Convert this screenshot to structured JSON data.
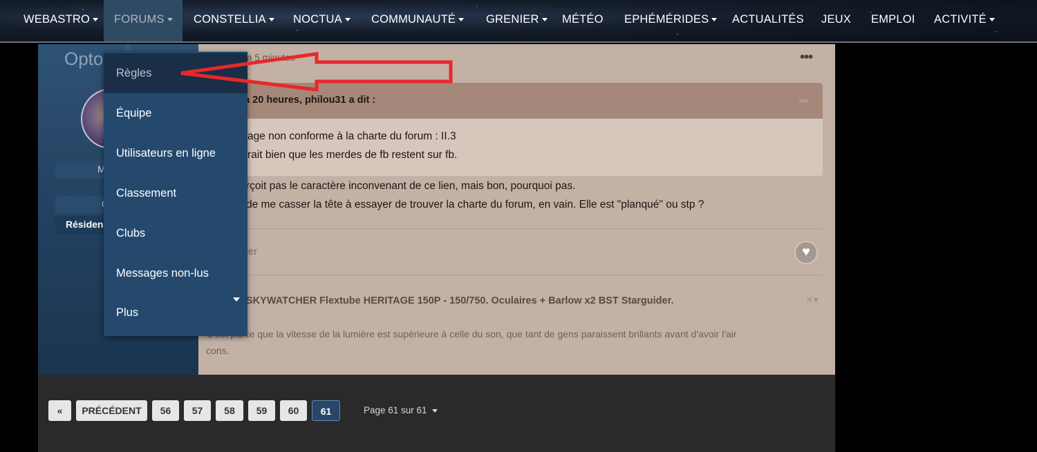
{
  "nav": {
    "items": [
      {
        "label": "WEBASTRO",
        "caret": true
      },
      {
        "label": "FORUMS",
        "caret": true,
        "active": true
      },
      {
        "label": "CONSTELLIA",
        "caret": true
      },
      {
        "label": "NOCTUA",
        "caret": true
      },
      {
        "label": "COMMUNAUTÉ",
        "caret": true
      },
      {
        "label": "GRENIER",
        "caret": true
      },
      {
        "label": "MÉTÉO",
        "caret": false
      },
      {
        "label": "EPHÉMÉRIDES",
        "caret": true
      },
      {
        "label": "ACTUALITÉS",
        "caret": false
      },
      {
        "label": "JEUX",
        "caret": false
      },
      {
        "label": "EMPLOI",
        "caret": false
      },
      {
        "label": "ACTIVITÉ",
        "caret": true
      }
    ]
  },
  "dropdown": {
    "items": [
      "Règles",
      "Équipe",
      "Utilisateurs en ligne",
      "Classement",
      "Clubs",
      "Messages non-lus",
      "Plus"
    ]
  },
  "sidebar": {
    "name": "Opto",
    "m_label": "M",
    "c_label": "C",
    "resident": "Résiden"
  },
  "post": {
    "time": "a 5 minutes",
    "quote": {
      "cite": "y a 20 heures, philou31 a dit :",
      "line1": "age non conforme à la charte du forum : II.3",
      "line2": "rait bien que les merdes de fb restent sur fb."
    },
    "body": {
      "line1": "rçoit pas le caractère inconvenant de ce lien, mais bon, pourquoi pas.",
      "line2": "de me casser la tête à essayer de trouver la charte du forum, en vain. Elle est \"planqué\" ou stp ?"
    },
    "react_text": "ter",
    "signature": "SKYWATCHER Flextube HERITAGE 150P - 150/750. Oculaires + Barlow x2  BST Starguider.",
    "sig_quote_line1": "C'est parce que la vitesse de la lumière est supérieure à celle du son, que tant de gens paraissent brillants avant d'avoir l'air",
    "sig_quote_line2": "cons."
  },
  "pagination": {
    "first": "«",
    "prev": "PRÉCÉDENT",
    "pages": [
      "56",
      "57",
      "58",
      "59",
      "60",
      "61"
    ],
    "current": "61",
    "info": "Page 61 sur 61"
  },
  "colors": {
    "annotation_arrow": "#e8282a",
    "nav_active": "#2f4a63",
    "dropdown_bg": "#24496d",
    "post_bg": "#c3b1a6"
  }
}
